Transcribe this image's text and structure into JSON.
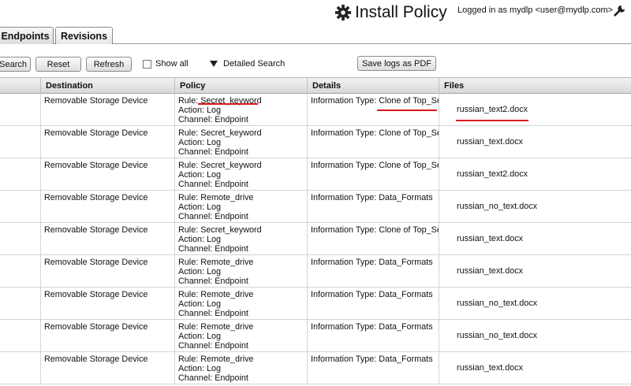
{
  "header": {
    "install_label": "Install Policy",
    "logged_in": "Logged in as mydlp <user@mydlp.com>"
  },
  "tabs": [
    {
      "label": "Endpoints"
    },
    {
      "label": "Revisions"
    }
  ],
  "toolbar": {
    "search_label": "Search",
    "reset_label": "Reset",
    "refresh_label": "Refresh",
    "show_all_label": "Show all",
    "detailed_search_label": "Detailed Search",
    "save_pdf_label": "Save logs as PDF"
  },
  "table": {
    "columns": [
      "Destination",
      "Policy",
      "Details",
      "Files"
    ],
    "rows": [
      {
        "destination": "Removable Storage Device",
        "rule": "Rule: Secret_keyword",
        "action": "Action: Log",
        "channel": "Channel: Endpoint",
        "details": "Information Type: Clone of Top_Secret",
        "file": "russian_text2.docx"
      },
      {
        "destination": "Removable Storage Device",
        "rule": "Rule: Secret_keyword",
        "action": "Action: Log",
        "channel": "Channel: Endpoint",
        "details": "Information Type: Clone of Top_Secret",
        "file": "russian_text.docx"
      },
      {
        "destination": "Removable Storage Device",
        "rule": "Rule: Secret_keyword",
        "action": "Action: Log",
        "channel": "Channel: Endpoint",
        "details": "Information Type: Clone of Top_Secret",
        "file": "russian_text2.docx"
      },
      {
        "destination": "Removable Storage Device",
        "rule": "Rule: Remote_drive",
        "action": "Action: Log",
        "channel": "Channel: Endpoint",
        "details": "Information Type: Data_Formats",
        "file": "russian_no_text.docx"
      },
      {
        "destination": "Removable Storage Device",
        "rule": "Rule: Secret_keyword",
        "action": "Action: Log",
        "channel": "Channel: Endpoint",
        "details": "Information Type: Clone of Top_Secret",
        "file": "russian_text.docx"
      },
      {
        "destination": "Removable Storage Device",
        "rule": "Rule: Remote_drive",
        "action": "Action: Log",
        "channel": "Channel: Endpoint",
        "details": "Information Type: Data_Formats",
        "file": "russian_text.docx"
      },
      {
        "destination": "Removable Storage Device",
        "rule": "Rule: Remote_drive",
        "action": "Action: Log",
        "channel": "Channel: Endpoint",
        "details": "Information Type: Data_Formats",
        "file": "russian_no_text.docx"
      },
      {
        "destination": "Removable Storage Device",
        "rule": "Rule: Remote_drive",
        "action": "Action: Log",
        "channel": "Channel: Endpoint",
        "details": "Information Type: Data_Formats",
        "file": "russian_no_text.docx"
      },
      {
        "destination": "Removable Storage Device",
        "rule": "Rule: Remote_drive",
        "action": "Action: Log",
        "channel": "Channel: Endpoint",
        "details": "Information Type: Data_Formats",
        "file": "russian_text.docx"
      }
    ]
  },
  "colors": {
    "annotation_red": "#d61a1a"
  }
}
